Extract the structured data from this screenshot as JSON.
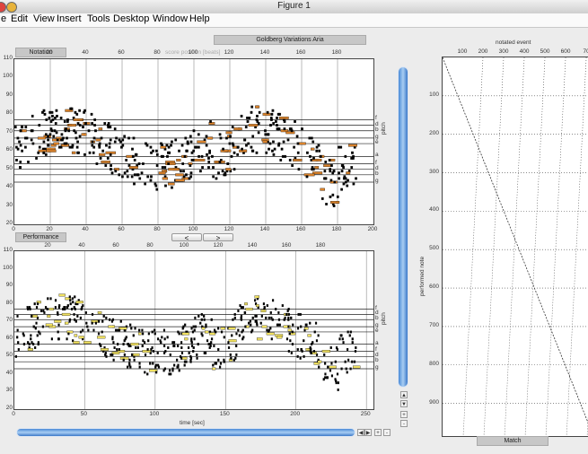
{
  "window": {
    "title": "Figure 1"
  },
  "menu": [
    "e",
    "Edit",
    "View",
    "Insert",
    "Tools",
    "Desktop",
    "Window",
    "Help"
  ],
  "piece_title": "Goldberg Variations Aria",
  "notation": {
    "label": "Notation",
    "xlabel": "score position [beats]",
    "ylabel": "pitch",
    "xticks": [
      "0",
      "20",
      "40",
      "60",
      "80",
      "100",
      "120",
      "140",
      "160",
      "180",
      "200"
    ],
    "yticks": [
      "20",
      "30",
      "40",
      "50",
      "60",
      "70",
      "80",
      "90",
      "100",
      "110"
    ],
    "staff_labels": [
      "f",
      "d",
      "b",
      "g",
      "e",
      "a",
      "f",
      "d",
      "b",
      "g"
    ]
  },
  "performance": {
    "label": "Performance",
    "xlabel": "time [sec]",
    "ylabel": "pitch",
    "xticks_bottom": [
      "0",
      "50",
      "100",
      "150",
      "200",
      "250"
    ],
    "xticks_top": [
      "20",
      "40",
      "60",
      "80",
      "100",
      "120",
      "140",
      "160",
      "180"
    ],
    "yticks": [
      "20",
      "30",
      "40",
      "50",
      "60",
      "70",
      "80",
      "90",
      "100",
      "110"
    ],
    "staff_labels": [
      "f",
      "d",
      "b",
      "g",
      "e",
      "a",
      "f",
      "d",
      "b",
      "g"
    ]
  },
  "nav": {
    "prev": "<",
    "next": ">"
  },
  "match": {
    "label": "Match",
    "xlabel": "notated event",
    "ylabel": "performed note",
    "xticks": [
      "100",
      "200",
      "300",
      "400",
      "500",
      "600",
      "70"
    ],
    "yticks": [
      "100",
      "200",
      "300",
      "400",
      "500",
      "600",
      "700",
      "800",
      "900"
    ]
  },
  "scroll": {
    "up": "▲",
    "down": "▼",
    "plus": "+",
    "minus": "-",
    "left": "◀",
    "right": "▶"
  },
  "colors": {
    "notation_fill": "#d9822b",
    "performance_fill": "#f0e060",
    "scroll": "#4a8ad6"
  }
}
